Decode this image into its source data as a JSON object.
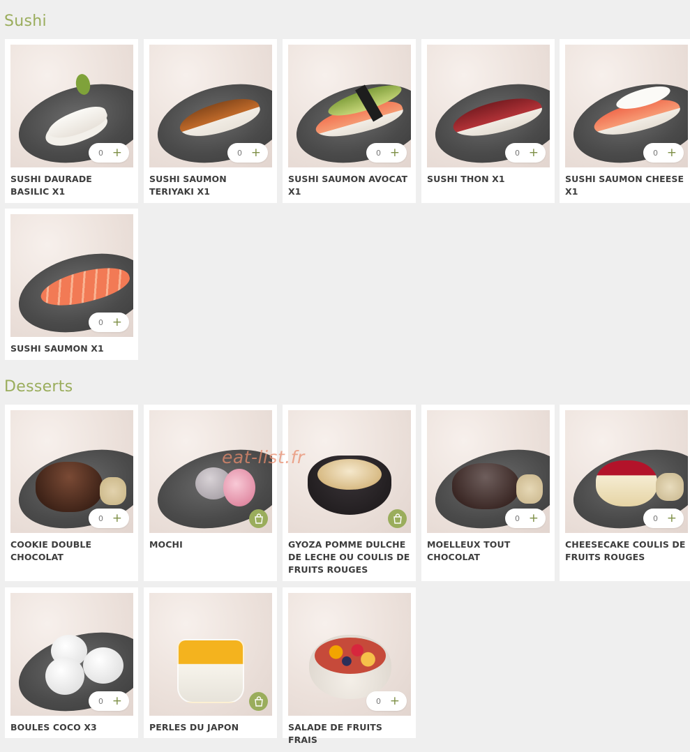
{
  "sections": [
    {
      "title": "Sushi",
      "items": [
        {
          "name": "SUSHI DAURADE BASILIC X1",
          "qty": "0",
          "control": "stepper"
        },
        {
          "name": "SUSHI SAUMON TERIYAKI X1",
          "qty": "0",
          "control": "stepper"
        },
        {
          "name": "SUSHI SAUMON AVOCAT X1",
          "qty": "0",
          "control": "stepper"
        },
        {
          "name": "SUSHI THON X1",
          "qty": "0",
          "control": "stepper"
        },
        {
          "name": "SUSHI SAUMON CHEESE X1",
          "qty": "0",
          "control": "stepper"
        },
        {
          "name": "SUSHI SAUMON X1",
          "qty": "0",
          "control": "stepper"
        }
      ]
    },
    {
      "title": "Desserts",
      "items": [
        {
          "name": "COOKIE DOUBLE CHOCOLAT",
          "qty": "0",
          "control": "stepper"
        },
        {
          "name": "MOCHI",
          "control": "bag"
        },
        {
          "name": "GYOZA POMME DULCHE DE LECHE OU COULIS DE FRUITS ROUGES",
          "control": "bag"
        },
        {
          "name": "MOELLEUX TOUT CHOCOLAT",
          "qty": "0",
          "control": "stepper"
        },
        {
          "name": "CHEESECAKE COULIS DE FRUITS ROUGES",
          "qty": "0",
          "control": "stepper"
        },
        {
          "name": "BOULES COCO X3",
          "qty": "0",
          "control": "stepper"
        },
        {
          "name": "PERLES DU JAPON",
          "control": "bag"
        },
        {
          "name": "SALADE DE FRUITS FRAIS",
          "qty": "0",
          "control": "stepper"
        }
      ]
    }
  ],
  "watermark": "eat-list.fr",
  "icons": {
    "add": "plus-icon",
    "unavailable": "shopping-bag-icon"
  },
  "colors": {
    "accent": "#9aad5c",
    "background": "#efefef",
    "card": "#ffffff",
    "text": "#3d3d3d"
  }
}
